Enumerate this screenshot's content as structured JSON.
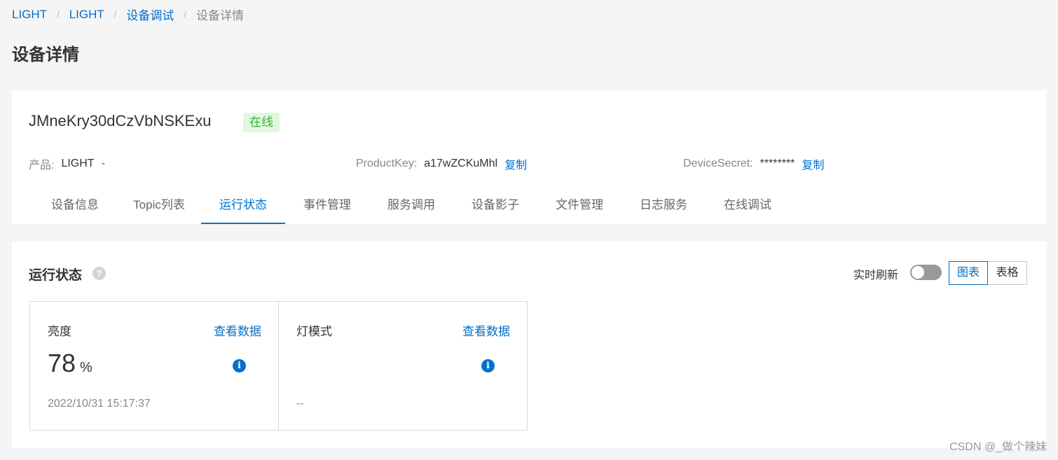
{
  "breadcrumb": {
    "items": [
      "LIGHT",
      "LIGHT",
      "设备调试"
    ],
    "current": "设备详情",
    "separator": "/"
  },
  "page_title": "设备详情",
  "device": {
    "name": "JMneKry30dCzVbNSKExu",
    "status": "在线",
    "product_label": "产品:",
    "product_value": "LIGHT",
    "product_link": "-",
    "product_key_label": "ProductKey:",
    "product_key_value": "a17wZCKuMhl",
    "copy_label": "复制",
    "device_secret_label": "DeviceSecret:",
    "device_secret_value": "********"
  },
  "tabs": [
    "设备信息",
    "Topic列表",
    "运行状态",
    "事件管理",
    "服务调用",
    "设备影子",
    "文件管理",
    "日志服务",
    "在线调试"
  ],
  "active_tab": "运行状态",
  "runtime": {
    "title": "运行状态",
    "help_icon": "?",
    "refresh_label": "实时刷新",
    "refresh_on": false,
    "view_chart": "图表",
    "view_table": "表格",
    "properties": [
      {
        "name": "亮度",
        "link": "查看数据",
        "value": "78",
        "unit": "%",
        "time": "2022/10/31 15:17:37",
        "info_icon": "i"
      },
      {
        "name": "灯模式",
        "link": "查看数据",
        "value": "",
        "unit": "",
        "time": "--",
        "info_icon": "i"
      }
    ]
  },
  "watermark": "CSDN @_做个辣妹",
  "colors": {
    "accent": "#0070cc",
    "online_bg": "#e3f6df",
    "online_text": "#34b73a"
  }
}
